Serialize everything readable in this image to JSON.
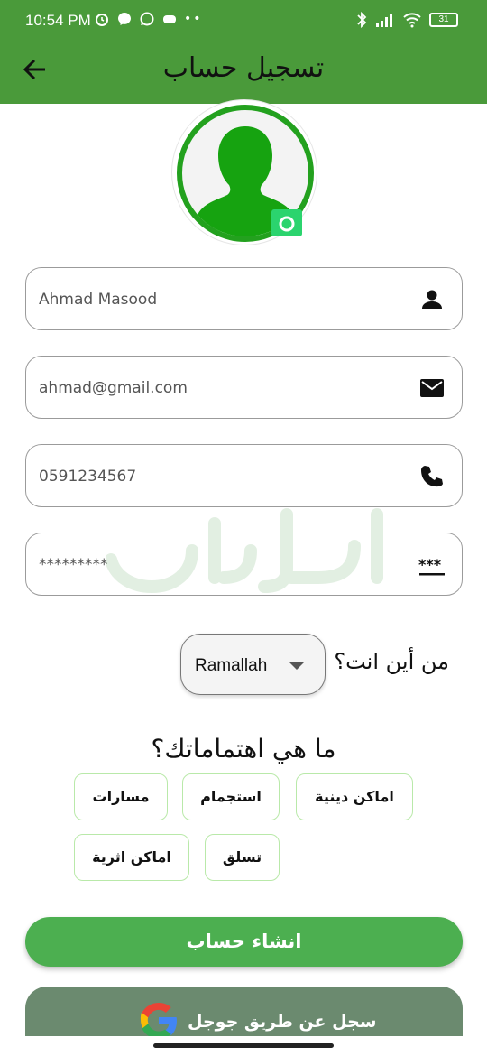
{
  "status_bar": {
    "time": "10:54 PM",
    "battery": "31",
    "left_icons": [
      "alarm-icon",
      "messenger-icon",
      "whatsapp-icon",
      "game-icon",
      "dots-icon"
    ],
    "right_icons": [
      "bluetooth-icon",
      "signal-icon",
      "wifi-icon",
      "battery-icon"
    ]
  },
  "header": {
    "title": "تسجيل حساب",
    "accent_color": "#4a9a3a"
  },
  "form": {
    "name_value": "Ahmad Masood",
    "email_value": "ahmad@gmail.com",
    "phone_value": "0591234567",
    "password_value": "*********",
    "field_icons": [
      "person-icon",
      "mail-icon",
      "phone-icon",
      "password-icon"
    ]
  },
  "location": {
    "label": "من أين انت؟",
    "selected_city": "Ramallah"
  },
  "interests": {
    "label": "ما هي اهتماماتك؟",
    "chips": [
      "اماكن دينية",
      "استجمام",
      "مسارات",
      "تسلق",
      "اماكن اثرية"
    ]
  },
  "actions": {
    "create_account": "انشاء حساب",
    "google_signup": "سجل عن طريق جوجل",
    "primary_color": "#4caf50"
  }
}
